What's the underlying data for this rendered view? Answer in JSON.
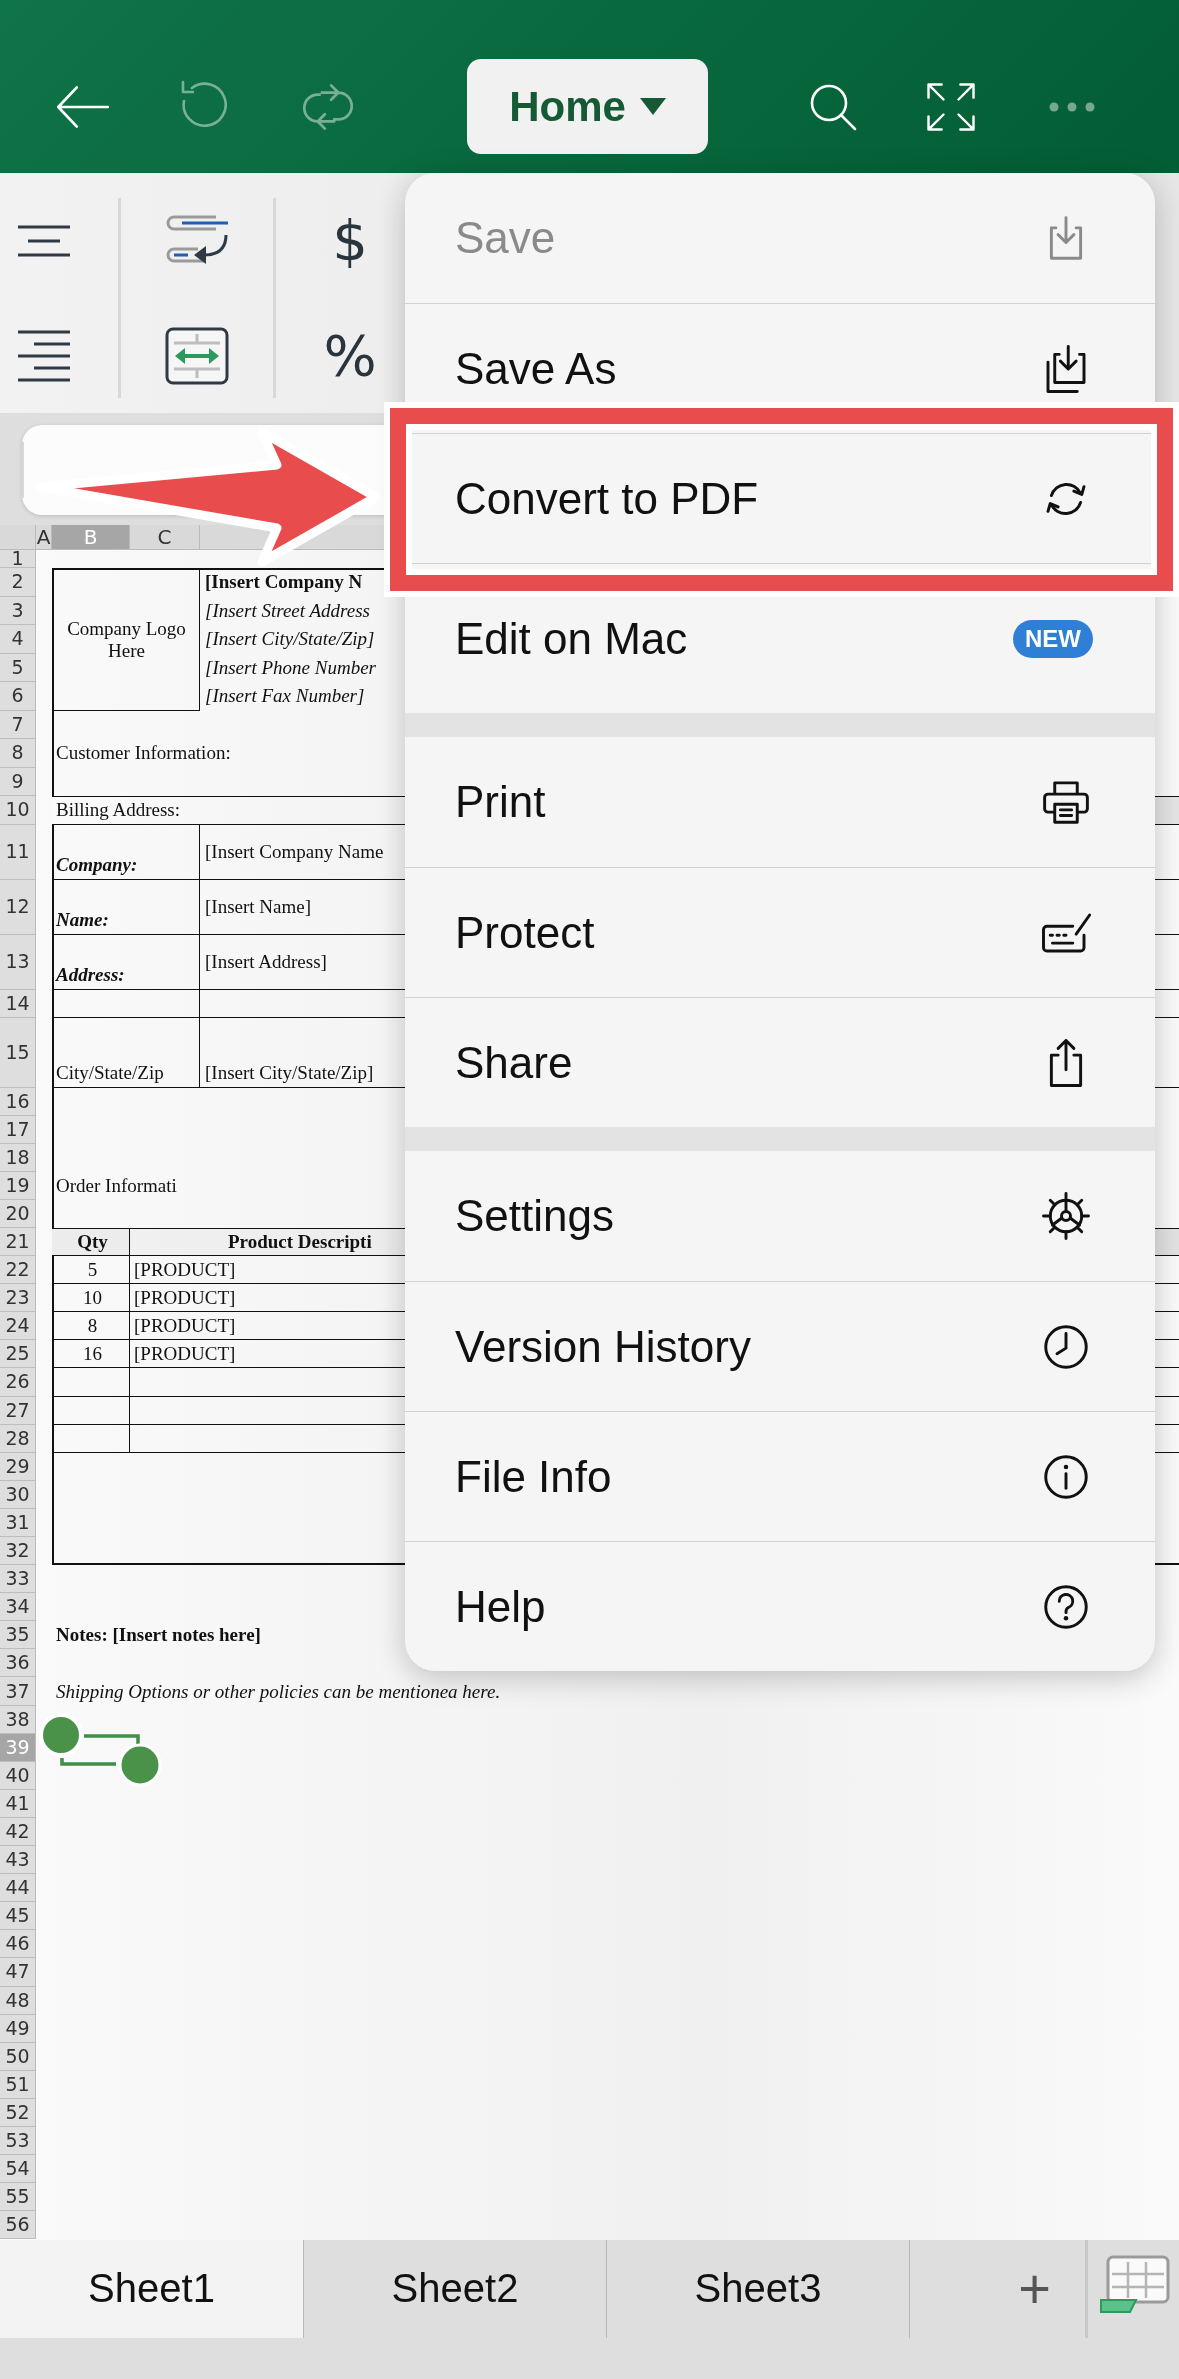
{
  "toolbar_left": [
    {
      "kind": "back",
      "disabled": false
    },
    {
      "kind": "undo",
      "disabled": true
    },
    {
      "kind": "redo",
      "disabled": true
    }
  ],
  "ribbon_tab": {
    "label": "Home"
  },
  "toolbar_right": [
    {
      "kind": "search",
      "disabled": false
    },
    {
      "kind": "fullscreen",
      "disabled": false
    },
    {
      "kind": "more",
      "disabled": true
    }
  ],
  "ribbon": {
    "groups": [
      [
        {
          "kind": "align-center"
        },
        {
          "kind": "align-right"
        }
      ],
      [
        {
          "kind": "wrap-text"
        },
        {
          "kind": "merge-cells"
        }
      ],
      [
        {
          "kind": "symbol",
          "label": "$"
        },
        {
          "kind": "symbol",
          "label": "%"
        }
      ]
    ]
  },
  "columns": [
    {
      "label": "A",
      "selected": false
    },
    {
      "label": "B",
      "selected": true
    },
    {
      "label": "C",
      "selected": false
    }
  ],
  "rows": [
    {
      "label": "1",
      "selected": false
    },
    {
      "label": "2",
      "selected": false
    },
    {
      "label": "3",
      "selected": false
    },
    {
      "label": "4",
      "selected": false
    },
    {
      "label": "5",
      "selected": false
    },
    {
      "label": "6",
      "selected": false
    },
    {
      "label": "7",
      "selected": false
    },
    {
      "label": "8",
      "selected": false
    },
    {
      "label": "9",
      "selected": false
    },
    {
      "label": "10",
      "selected": false
    },
    {
      "label": "11",
      "selected": false
    },
    {
      "label": "12",
      "selected": false
    },
    {
      "label": "13",
      "selected": false
    },
    {
      "label": "14",
      "selected": false
    },
    {
      "label": "15",
      "selected": false
    },
    {
      "label": "16",
      "selected": false
    },
    {
      "label": "17",
      "selected": false
    },
    {
      "label": "18",
      "selected": false
    },
    {
      "label": "19",
      "selected": false
    },
    {
      "label": "20",
      "selected": false
    },
    {
      "label": "21",
      "selected": false
    },
    {
      "label": "22",
      "selected": false
    },
    {
      "label": "23",
      "selected": false
    },
    {
      "label": "24",
      "selected": false
    },
    {
      "label": "25",
      "selected": false
    },
    {
      "label": "26",
      "selected": false
    },
    {
      "label": "27",
      "selected": false
    },
    {
      "label": "28",
      "selected": false
    },
    {
      "label": "29",
      "selected": false
    },
    {
      "label": "30",
      "selected": false
    },
    {
      "label": "31",
      "selected": false
    },
    {
      "label": "32",
      "selected": false
    },
    {
      "label": "33",
      "selected": false
    },
    {
      "label": "34",
      "selected": false
    },
    {
      "label": "35",
      "selected": false
    },
    {
      "label": "36",
      "selected": false
    },
    {
      "label": "37",
      "selected": false
    },
    {
      "label": "38",
      "selected": false
    },
    {
      "label": "39",
      "selected": true
    },
    {
      "label": "40",
      "selected": false
    },
    {
      "label": "41",
      "selected": false
    },
    {
      "label": "42",
      "selected": false
    },
    {
      "label": "43",
      "selected": false
    },
    {
      "label": "44",
      "selected": false
    },
    {
      "label": "45",
      "selected": false
    },
    {
      "label": "46",
      "selected": false
    },
    {
      "label": "47",
      "selected": false
    },
    {
      "label": "48",
      "selected": false
    },
    {
      "label": "49",
      "selected": false
    },
    {
      "label": "50",
      "selected": false
    },
    {
      "label": "51",
      "selected": false
    },
    {
      "label": "52",
      "selected": false
    },
    {
      "label": "53",
      "selected": false
    },
    {
      "label": "54",
      "selected": false
    },
    {
      "label": "55",
      "selected": false
    },
    {
      "label": "56",
      "selected": false
    }
  ],
  "form": {
    "logo": "Company Logo Here",
    "company_lines": [
      {
        "text": "[Insert Company N",
        "kind": "name"
      },
      {
        "text": "[Insert Street Address",
        "kind": "detail"
      },
      {
        "text": "[Insert City/State/Zip]",
        "kind": "detail"
      },
      {
        "text": "[Insert Phone Number",
        "kind": "detail"
      },
      {
        "text": "[Insert Fax Number]",
        "kind": "detail"
      }
    ],
    "customer_heading": "Customer Information:",
    "billing_heading": "Billing Address:",
    "billing_fields": [
      {
        "label": "Company:",
        "emphasis": true,
        "value": "[Insert Company Name"
      },
      {
        "label": "Name:",
        "emphasis": true,
        "value": "[Insert Name]"
      },
      {
        "label": "Address:",
        "emphasis": true,
        "value": "[Insert Address]"
      },
      {
        "label": "City/State/Zip",
        "emphasis": false,
        "value": "[Insert City/State/Zip]"
      }
    ],
    "order_heading": "Order Informati",
    "order_columns": [
      "Qty",
      "Product Descripti"
    ],
    "order_rows": [
      {
        "qty": "5",
        "product": "[PRODUCT]"
      },
      {
        "qty": "10",
        "product": "[PRODUCT]"
      },
      {
        "qty": "8",
        "product": "[PRODUCT]"
      },
      {
        "qty": "16",
        "product": "[PRODUCT]"
      }
    ],
    "notes": "Notes: [Insert notes here]",
    "policy": "Shipping Options or other policies can be mentionea here."
  },
  "menu": {
    "groups": [
      [
        {
          "label": "Save",
          "disabled": true,
          "highlighted": false
        },
        {
          "label": "Save As",
          "disabled": false,
          "highlighted": false
        },
        {
          "label": "Convert to PDF",
          "disabled": false,
          "highlighted": true
        },
        {
          "label": "Edit on Mac",
          "disabled": false,
          "highlighted": false,
          "badge": "NEW"
        }
      ],
      [
        {
          "label": "Print",
          "disabled": false,
          "highlighted": false
        },
        {
          "label": "Protect",
          "disabled": false,
          "highlighted": false
        },
        {
          "label": "Share",
          "disabled": false,
          "highlighted": false
        }
      ],
      [
        {
          "label": "Settings",
          "disabled": false,
          "highlighted": false
        },
        {
          "label": "Version History",
          "disabled": false,
          "highlighted": false
        },
        {
          "label": "File Info",
          "disabled": false,
          "highlighted": false
        },
        {
          "label": "Help",
          "disabled": false,
          "highlighted": false
        }
      ]
    ]
  },
  "sheet_tabs": [
    {
      "label": "Sheet1",
      "selected": true
    },
    {
      "label": "Sheet2",
      "selected": false
    },
    {
      "label": "Sheet3",
      "selected": false
    }
  ],
  "add_sheet": {
    "label": "+"
  }
}
